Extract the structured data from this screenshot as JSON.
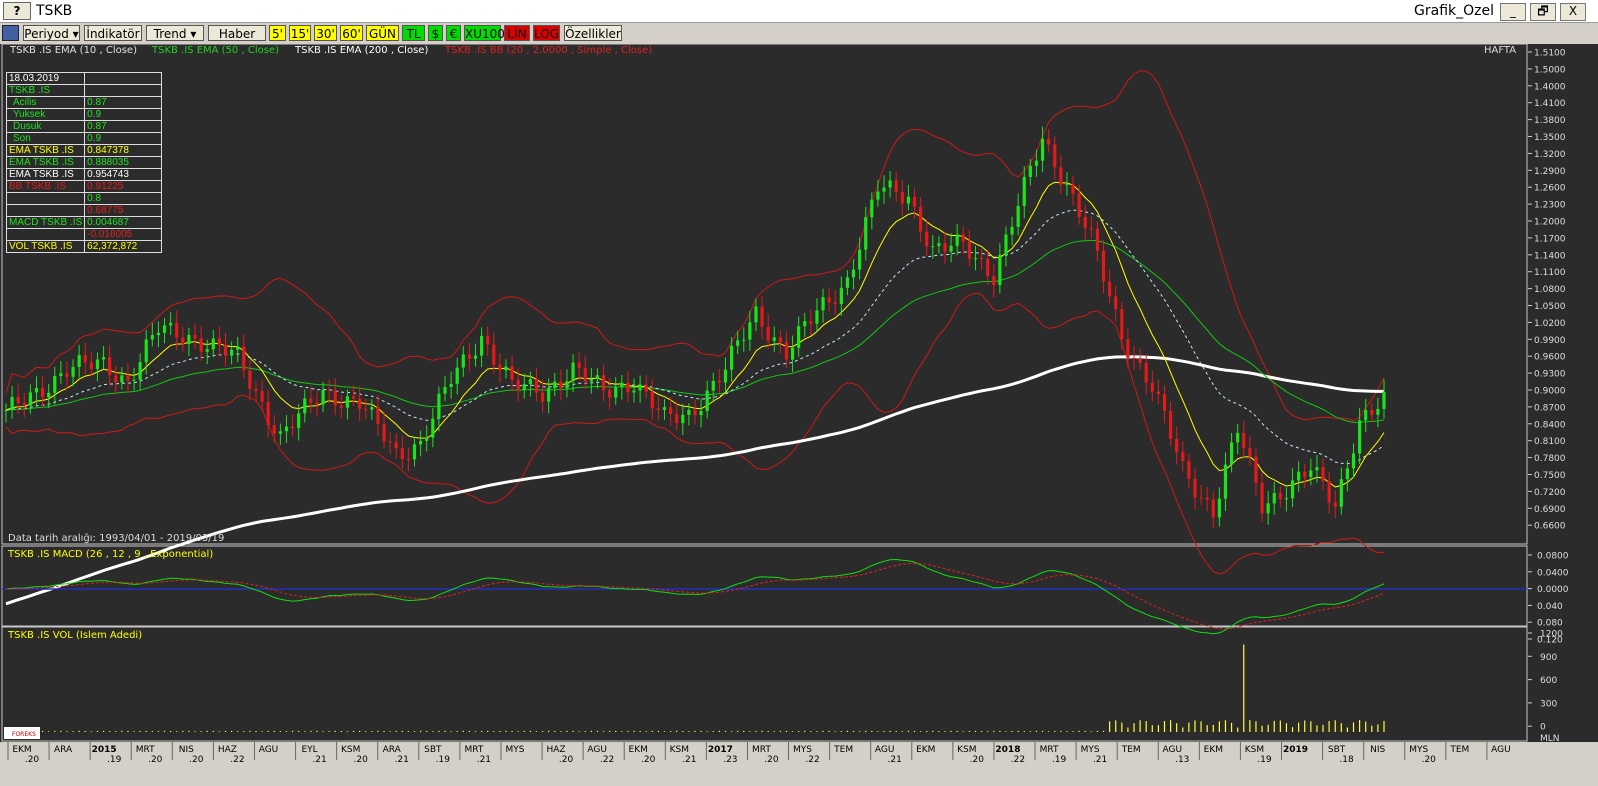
{
  "window": {
    "help_label": "?",
    "title": "TSKB",
    "layout_name": "Grafik_Ozel",
    "minimize": "_",
    "restore": "🗗",
    "close": "X"
  },
  "toolbar": {
    "periyod": "Periyod",
    "indikator": "İndikatör",
    "trend": "Trend",
    "haber": "Haber",
    "b5": "5'",
    "b15": "15'",
    "b30": "30'",
    "b60": "60'",
    "gun": "GÜN",
    "tl": "TL",
    "usd": "$",
    "eur": "€",
    "xu100": "XU100",
    "lin": "LİN",
    "log": "LOG",
    "ozellikler": "Özellikler"
  },
  "legend": {
    "ema10": "TSKB .IS EMA (10 , Close)",
    "ema50": "TSKB .IS EMA (50 , Close)",
    "ema200": "TSKB .IS EMA (200 , Close)",
    "bb": "TSKB .IS BB (20 , 2.0000 , Simple , Close)",
    "period": "HAFTA"
  },
  "info": {
    "date": "18.03.2019",
    "symbol": "TSKB .IS",
    "rows": [
      {
        "label": "Acilis",
        "value": "0.87"
      },
      {
        "label": "Yuksek",
        "value": "0.9"
      },
      {
        "label": "Dusuk",
        "value": "0.87"
      },
      {
        "label": "Son",
        "value": "0.9"
      }
    ],
    "ema10_label": "EMA TSKB .IS",
    "ema10_value": "0.847378",
    "ema50_label": "EMA TSKB .IS",
    "ema50_value": "0.888035",
    "ema200_label": "EMA TSKB .IS",
    "ema200_value": "0.954743",
    "bb_label": "BB TSKB .IS",
    "bb_upper": "0.91225",
    "bb_mid": "0.8",
    "bb_lower": "0.68775",
    "macd_label": "MACD TSKB .IS",
    "macd_value": "0.004687",
    "macd_signal": "-0.016005",
    "vol_label": "VOL TSKB .IS",
    "vol_value": "62,372,872"
  },
  "date_range": "Data tarih aralığı: 1993/04/01 - 2019/03/19",
  "macd_title": "TSKB .IS MACD (26 , 12 , 9 , Exponential)",
  "vol_title": "TSKB .IS VOL (Islem Adedi)",
  "logo_text": "FOREKS",
  "colors": {
    "up": "#19e619",
    "down": "#e61919",
    "ema10": "#ffff00",
    "ema50": "#10c810",
    "ema200": "#ffffff",
    "bb": "#d01818",
    "macd": "#10e010",
    "signal": "#e02020",
    "zero": "#2030c0",
    "volume": "#ffff33"
  },
  "chart_data": {
    "type": "line",
    "title": "TSKB",
    "period": "weekly",
    "price_axis": {
      "ticks": [
        "1.5100",
        "1.5000",
        "1.4000",
        "1.4100",
        "1.3800",
        "1.3500",
        "1.3200",
        "1.2900",
        "1.2600",
        "1.2300",
        "1.2000",
        "1.1700",
        "1.1400",
        "1.1100",
        "1.0800",
        "1.0500",
        "1.0200",
        "0.9900",
        "0.9600",
        "0.9300",
        "0.9000",
        "0.8700",
        "0.8400",
        "0.8100",
        "0.7800",
        "0.7500",
        "0.7200",
        "0.6900",
        "0.6600"
      ]
    },
    "macd_axis": {
      "ticks": [
        "0.0800",
        "0.0400",
        "0.0000",
        "0.040",
        "0.080",
        "0.120"
      ]
    },
    "volume_axis": {
      "ticks": [
        "1200",
        "900",
        "600",
        "300",
        "0"
      ],
      "unit": "MLN"
    },
    "time_axis": [
      {
        "m": "EKM",
        "y": ".20"
      },
      {
        "m": "ARA",
        "y": ""
      },
      {
        "m": "2015",
        "y": ".19",
        "b": true
      },
      {
        "m": "MRT",
        "y": ".20"
      },
      {
        "m": "NIS",
        "y": ".20"
      },
      {
        "m": "HAZ",
        "y": ".22"
      },
      {
        "m": "AGU",
        "y": ""
      },
      {
        "m": "EYL",
        "y": ".21"
      },
      {
        "m": "KSM",
        "y": ".20"
      },
      {
        "m": "ARA",
        "y": ".21"
      },
      {
        "m": "SBT",
        "y": ".19"
      },
      {
        "m": "MRT",
        "y": ".21"
      },
      {
        "m": "MYS",
        "y": ""
      },
      {
        "m": "HAZ",
        "y": ".20"
      },
      {
        "m": "AGU",
        "y": ".22"
      },
      {
        "m": "EKM",
        "y": ".20"
      },
      {
        "m": "KSM",
        "y": ".21"
      },
      {
        "m": "2017",
        "y": ".23",
        "b": true
      },
      {
        "m": "MRT",
        "y": ".20"
      },
      {
        "m": "MYS",
        "y": ".22"
      },
      {
        "m": "TEM",
        "y": ""
      },
      {
        "m": "AGU",
        "y": ".21"
      },
      {
        "m": "EKM",
        "y": ""
      },
      {
        "m": "KSM",
        "y": ".20"
      },
      {
        "m": "2018",
        "y": ".22",
        "b": true
      },
      {
        "m": "MRT",
        "y": ".19"
      },
      {
        "m": "MYS",
        "y": ".21"
      },
      {
        "m": "TEM",
        "y": ""
      },
      {
        "m": "AGU",
        "y": ".13"
      },
      {
        "m": "EKM",
        "y": ""
      },
      {
        "m": "KSM",
        "y": ".19"
      },
      {
        "m": "2019",
        "y": "",
        "b": true
      },
      {
        "m": "SBT",
        "y": ".18"
      },
      {
        "m": "NIS",
        "y": ""
      },
      {
        "m": "MYS",
        "y": ".20"
      },
      {
        "m": "TEM",
        "y": ""
      },
      {
        "m": "AGU",
        "y": ""
      }
    ],
    "ylim": [
      0.655,
      1.515
    ],
    "close_anchors": [
      [
        0,
        0.88
      ],
      [
        10,
        0.96
      ],
      [
        16,
        0.97
      ],
      [
        20,
        0.94
      ],
      [
        25,
        1.03
      ],
      [
        30,
        1.02
      ],
      [
        38,
        0.98
      ],
      [
        45,
        0.84
      ],
      [
        52,
        0.92
      ],
      [
        58,
        0.9
      ],
      [
        64,
        0.81
      ],
      [
        68,
        0.83
      ],
      [
        73,
        0.94
      ],
      [
        78,
        1.02
      ],
      [
        83,
        0.93
      ],
      [
        88,
        0.92
      ],
      [
        93,
        0.96
      ],
      [
        98,
        0.92
      ],
      [
        103,
        0.94
      ],
      [
        108,
        0.87
      ],
      [
        112,
        0.88
      ],
      [
        118,
        0.96
      ],
      [
        123,
        1.06
      ],
      [
        128,
        0.99
      ],
      [
        133,
        1.06
      ],
      [
        138,
        1.12
      ],
      [
        143,
        1.28
      ],
      [
        148,
        1.27
      ],
      [
        152,
        1.17
      ],
      [
        157,
        1.18
      ],
      [
        162,
        1.13
      ],
      [
        166,
        1.25
      ],
      [
        170,
        1.37
      ],
      [
        174,
        1.29
      ],
      [
        178,
        1.19
      ],
      [
        183,
        1.02
      ],
      [
        188,
        0.93
      ],
      [
        193,
        0.78
      ],
      [
        198,
        0.71
      ],
      [
        202,
        0.85
      ],
      [
        206,
        0.72
      ],
      [
        210,
        0.75
      ],
      [
        214,
        0.78
      ],
      [
        218,
        0.72
      ],
      [
        222,
        0.87
      ],
      [
        226,
        0.9
      ]
    ],
    "volume_spike_index": 203
  }
}
